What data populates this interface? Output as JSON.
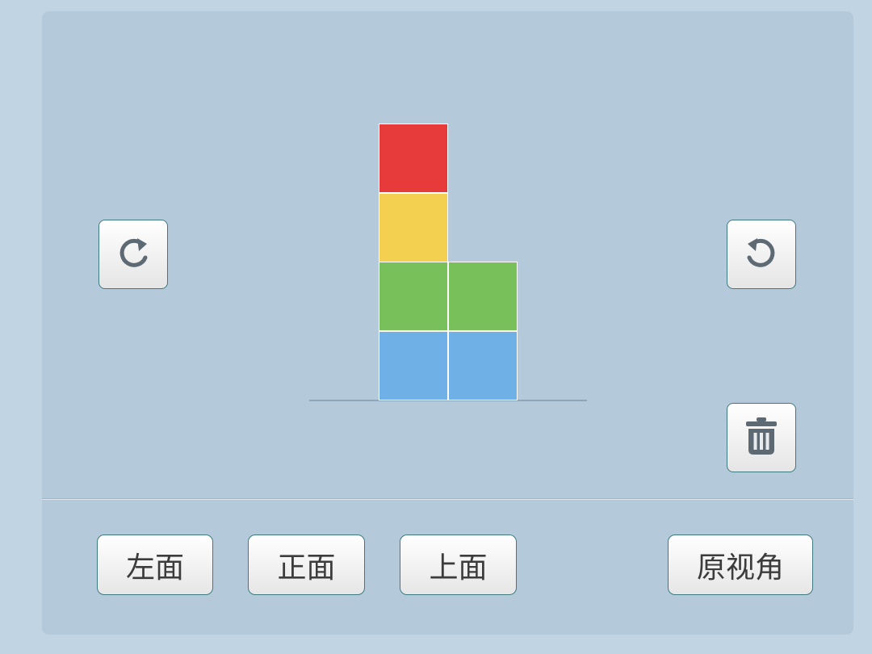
{
  "controls": {
    "rotate_right_icon": "rotate-clockwise-icon",
    "rotate_left_icon": "rotate-counterclockwise-icon",
    "delete_icon": "trash-icon"
  },
  "view_buttons": {
    "left": "左面",
    "front": "正面",
    "top": "上面",
    "reset": "原视角"
  },
  "cubes": [
    {
      "column": 1,
      "level": 1,
      "color": "#6fb1e6"
    },
    {
      "column": 2,
      "level": 1,
      "color": "#6fb1e6"
    },
    {
      "column": 1,
      "level": 2,
      "color": "#77c05a"
    },
    {
      "column": 2,
      "level": 2,
      "color": "#77c05a"
    },
    {
      "column": 1,
      "level": 3,
      "color": "#f3d04f"
    },
    {
      "column": 1,
      "level": 4,
      "color": "#e73b3b"
    }
  ],
  "colors": {
    "background": "#c1d4e3",
    "panel": "#b4c9da",
    "button_border": "#3f7a80",
    "icon": "#5e6a73"
  }
}
